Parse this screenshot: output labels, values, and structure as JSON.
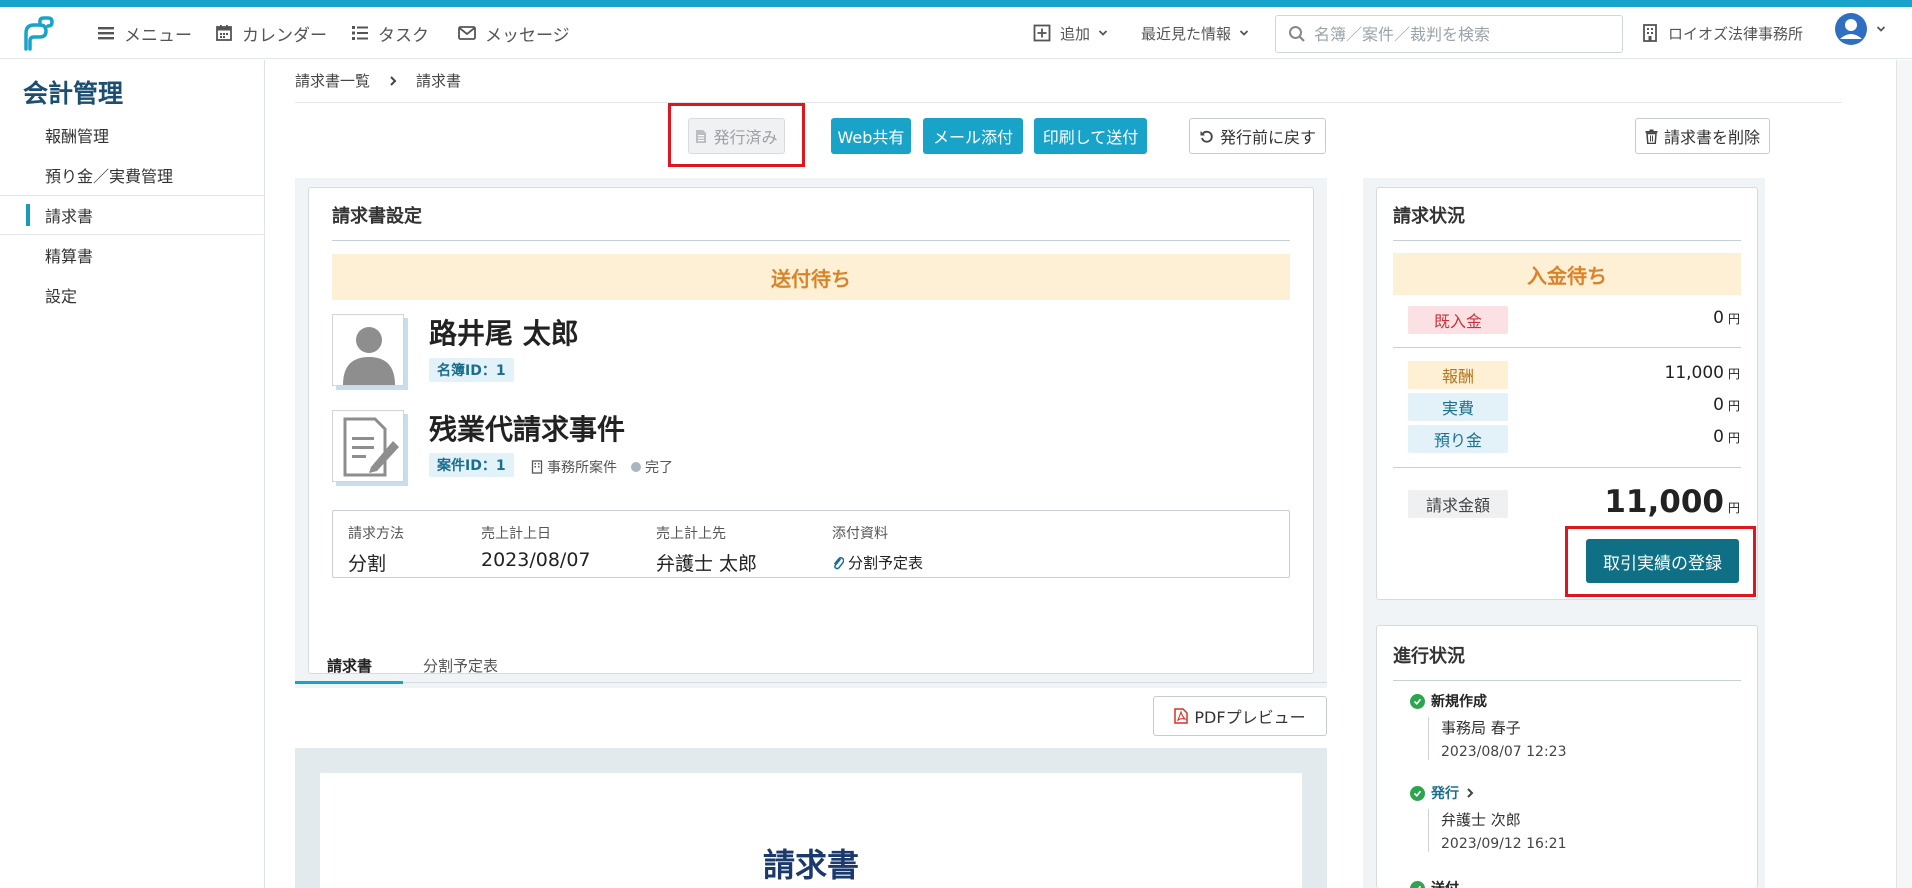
{
  "topbar": {
    "menu_label": "メニュー",
    "calendar_label": "カレンダー",
    "task_label": "タスク",
    "message_label": "メッセージ",
    "add_label": "追加",
    "recent_label": "最近見た情報",
    "search_placeholder": "名簿／案件／裁判を検索",
    "office_name": "ロイオズ法律事務所"
  },
  "sidebar": {
    "title": "会計管理",
    "items": [
      {
        "label": "報酬管理"
      },
      {
        "label": "預り金／実費管理"
      },
      {
        "label": "請求書"
      },
      {
        "label": "精算書"
      },
      {
        "label": "設定"
      }
    ]
  },
  "breadcrumb": {
    "parent": "請求書一覧",
    "current": "請求書"
  },
  "actions": {
    "issued": "発行済み",
    "web_share": "Web共有",
    "mail_attach": "メール添付",
    "print_send": "印刷して送付",
    "revert": "発行前に戻す",
    "delete": "請求書を削除"
  },
  "invoice_settings": {
    "title": "請求書設定",
    "status": "送付待ち",
    "client_name": "路井尾 太郎",
    "client_id": "名簿ID：1",
    "case_name": "残業代請求事件",
    "case_id": "案件ID：1",
    "case_type": "事務所案件",
    "case_status": "完了",
    "fields": {
      "method_label": "請求方法",
      "method_value": "分割",
      "sales_date_label": "売上計上日",
      "sales_date_value": "2023/08/07",
      "sales_dest_label": "売上計上先",
      "sales_dest_value": "弁護士 太郎",
      "attachment_label": "添付資料",
      "attachment_value": "分割予定表"
    }
  },
  "tabs": {
    "invoice": "請求書",
    "schedule": "分割予定表"
  },
  "preview": {
    "pdf_button": "PDFプレビュー",
    "doc_title": "請求書"
  },
  "billing_status": {
    "title": "請求状況",
    "status": "入金待ち",
    "received_label": "既入金",
    "received_value": "0",
    "fee_label": "報酬",
    "fee_value": "11,000",
    "expense_label": "実費",
    "expense_value": "0",
    "deposit_label": "預り金",
    "deposit_value": "0",
    "total_label": "請求金額",
    "total_value": "11,000",
    "unit": "円",
    "register_button": "取引実績の登録"
  },
  "progress": {
    "title": "進行状況",
    "steps": [
      {
        "label": "新規作成",
        "person": "事務局 春子",
        "date": "2023/08/07 12:23"
      },
      {
        "label": "発行",
        "person": "弁護士 次郎",
        "date": "2023/09/12 16:21"
      },
      {
        "label": "送付"
      }
    ]
  },
  "colors": {
    "accent": "#1aa3c9",
    "register_button": "#0e6f85",
    "highlight_box": "#e0161e",
    "pending_banner": "#fdf0d5",
    "pending_text": "#d9832a"
  }
}
